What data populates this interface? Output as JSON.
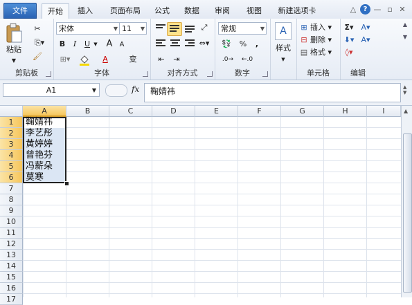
{
  "tabs": {
    "file": "文件",
    "items": [
      "开始",
      "插入",
      "页面布局",
      "公式",
      "数据",
      "审阅",
      "视图",
      "新建选项卡"
    ],
    "active_index": 0
  },
  "window_controls": {
    "collapse": "△",
    "help": "?",
    "minimize": "—",
    "restore": "▫",
    "close": "✕"
  },
  "ribbon": {
    "clipboard": {
      "label": "剪贴板",
      "paste": "粘贴"
    },
    "font": {
      "label": "字体",
      "name": "宋体",
      "size": "11",
      "bold": "B",
      "italic": "I",
      "underline": "U",
      "grow": "A",
      "shrink": "A",
      "color": "A",
      "wen": "变"
    },
    "alignment": {
      "label": "对齐方式"
    },
    "number": {
      "label": "数字",
      "format": "常规",
      "percent": "%",
      "comma": ","
    },
    "styles": {
      "label": "样式",
      "button": "样式"
    },
    "cells": {
      "label": "单元格",
      "insert": "插入",
      "delete": "删除",
      "format": "格式"
    },
    "editing": {
      "label": "编辑",
      "sum": "Σ",
      "sort": "A",
      "find": "A"
    }
  },
  "formula_bar": {
    "name_box": "A1",
    "fx": "fx",
    "content": "鞠婧祎"
  },
  "grid": {
    "columns": [
      "A",
      "B",
      "C",
      "D",
      "E",
      "F",
      "G",
      "H",
      "I"
    ],
    "selected_column": "A",
    "rows": [
      "1",
      "2",
      "3",
      "4",
      "5",
      "6",
      "7",
      "8",
      "9",
      "10",
      "11",
      "12",
      "13",
      "14",
      "15",
      "16",
      "17"
    ],
    "selected_rows": [
      "1",
      "2",
      "3",
      "4",
      "5",
      "6"
    ],
    "cells_a": [
      "鞠婧祎",
      "李艺彤",
      "黄婷婷",
      "曾艳芬",
      "冯薪朵",
      "莫寒"
    ]
  }
}
